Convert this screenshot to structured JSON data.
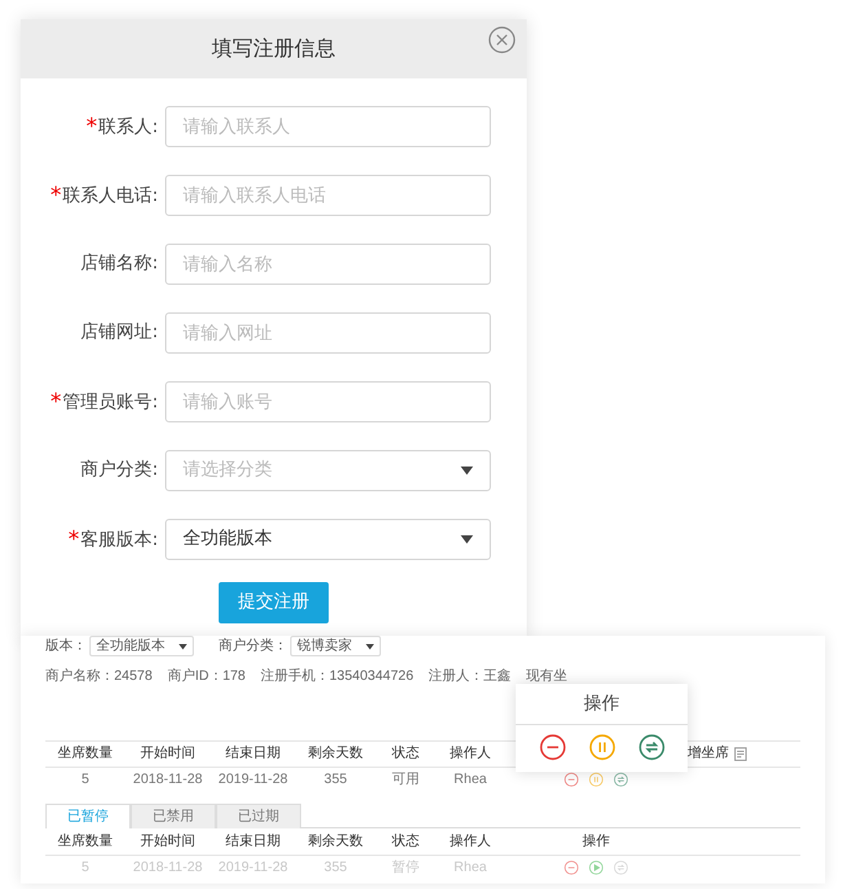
{
  "dialog": {
    "title": "填写注册信息",
    "fields": [
      {
        "star": "*",
        "label": "联系人:",
        "kind": "input",
        "placeholder": "请输入联系人"
      },
      {
        "star": "*",
        "label": "联系人电话:",
        "kind": "input",
        "placeholder": "请输入联系人电话"
      },
      {
        "label": "店铺名称:",
        "kind": "input",
        "placeholder": "请输入名称"
      },
      {
        "label": "店铺网址:",
        "kind": "input",
        "placeholder": "请输入网址"
      },
      {
        "star": "*",
        "label": "管理员账号:",
        "kind": "input",
        "placeholder": "请输入账号"
      },
      {
        "label": "商户分类:",
        "kind": "select",
        "placeholder": "请选择分类"
      },
      {
        "star": "*",
        "label": "客服版本:",
        "kind": "select",
        "value": "全功能版本"
      }
    ],
    "submit": "提交注册"
  },
  "panel": {
    "filters": [
      {
        "label": "版本：",
        "value": "全功能版本"
      },
      {
        "label": "商户分类：",
        "value": "锐博卖家"
      }
    ],
    "info": [
      "商户名称：24578",
      "商户ID：178",
      "注册手机：13540344726",
      "注册人：王鑫",
      "现有坐"
    ],
    "table": {
      "columns": [
        "坐席数量",
        "开始时间",
        "结束日期",
        "剩余天数",
        "状态",
        "操作人"
      ],
      "extra_column": "增坐席",
      "rows": [
        {
          "cells": [
            "5",
            "2018-11-28",
            "2019-11-28",
            "355",
            "可用",
            "Rhea"
          ],
          "actions": [
            {
              "kind": "remove",
              "disabled": false
            },
            {
              "kind": "pause",
              "disabled": false
            },
            {
              "kind": "swap",
              "disabled": false
            }
          ]
        }
      ]
    },
    "tabs": [
      {
        "label": "已暂停",
        "selected": true
      },
      {
        "label": "已禁用",
        "selected": false
      },
      {
        "label": "已过期",
        "selected": false
      }
    ],
    "table2": {
      "columns": [
        "坐席数量",
        "开始时间",
        "结束日期",
        "剩余天数",
        "状态",
        "操作人",
        "操作"
      ],
      "rows": [
        {
          "cells": [
            "5",
            "2018-11-28",
            "2019-11-28",
            "355",
            "暂停",
            "Rhea"
          ],
          "actions": [
            {
              "kind": "remove",
              "disabled": false
            },
            {
              "kind": "play",
              "disabled": false
            },
            {
              "kind": "swap",
              "disabled": true
            }
          ]
        }
      ]
    },
    "popup": {
      "title": "操作",
      "actions": [
        {
          "kind": "remove",
          "disabled": false
        },
        {
          "kind": "pause",
          "disabled": false
        },
        {
          "kind": "swap",
          "disabled": false
        }
      ]
    }
  }
}
